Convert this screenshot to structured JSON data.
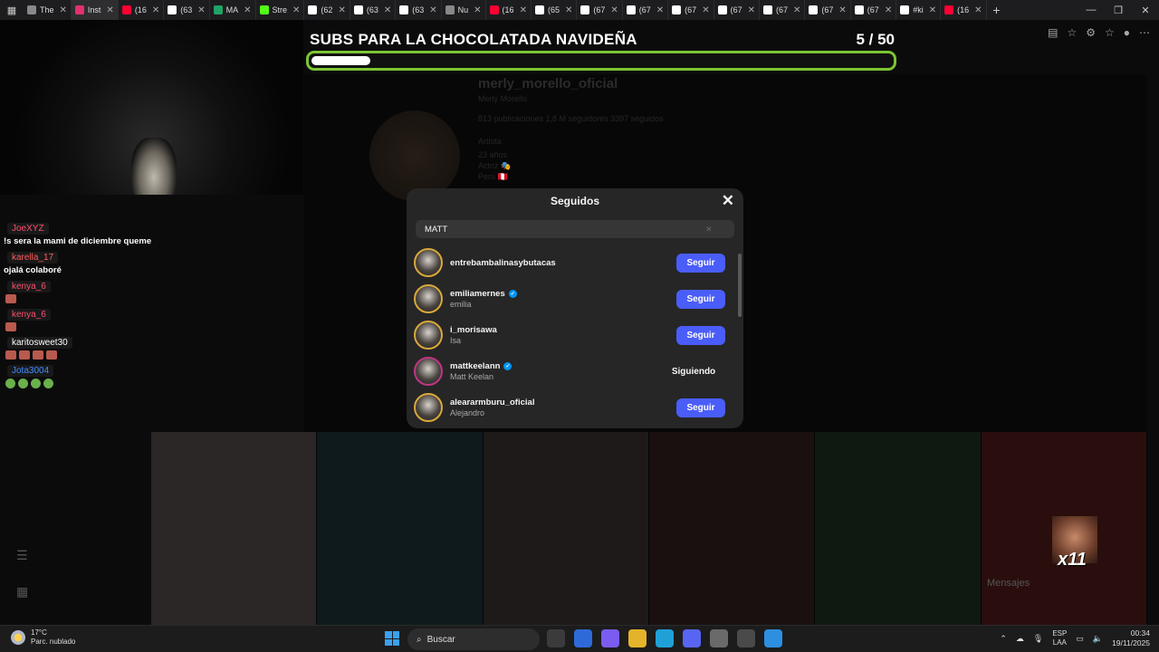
{
  "browser": {
    "tabs": [
      {
        "label": "The",
        "color": "#888888"
      },
      {
        "label": "Inst",
        "color": "#e1306c",
        "active": true
      },
      {
        "label": "(16",
        "color": "#ff0033"
      },
      {
        "label": "(63",
        "color": "#ffffff"
      },
      {
        "label": "MA",
        "color": "#21a366"
      },
      {
        "label": "Stre",
        "color": "#53fc18"
      },
      {
        "label": "(62",
        "color": "#ffffff"
      },
      {
        "label": "(63",
        "color": "#ffffff"
      },
      {
        "label": "(63",
        "color": "#ffffff"
      },
      {
        "label": "Nu",
        "color": "#888888"
      },
      {
        "label": "(16",
        "color": "#ff0033"
      },
      {
        "label": "(65",
        "color": "#ffffff"
      },
      {
        "label": "(67",
        "color": "#ffffff"
      },
      {
        "label": "(67",
        "color": "#ffffff"
      },
      {
        "label": "(67",
        "color": "#ffffff"
      },
      {
        "label": "(67",
        "color": "#ffffff"
      },
      {
        "label": "(67",
        "color": "#ffffff"
      },
      {
        "label": "(67",
        "color": "#ffffff"
      },
      {
        "label": "(67",
        "color": "#ffffff"
      },
      {
        "label": "#ki",
        "color": "#ffffff"
      },
      {
        "label": "(16",
        "color": "#ff0033"
      }
    ]
  },
  "overlay": {
    "goal_title": "SUBS PARA LA CHOCOLATADA NAVIDEÑA",
    "goal_current": 5,
    "goal_total": 50,
    "goal_count_text": "5  / 50",
    "goal_fill_fraction": 0.1,
    "accent": "#7cc533"
  },
  "profile": {
    "username": "merly_morello_oficial",
    "fullname": "Merly Morello",
    "stats": "813 publicaciones    1,8 M seguidores    3397 seguidos",
    "bio1": "Artista",
    "bio2": "23 años",
    "bio3": "Actriz 🎭",
    "bio4": "Perú 🇵🇪"
  },
  "chat": [
    {
      "user": "JoeXYZ",
      "user_color": "#ff4f6d",
      "msg": "!s sera la mami de diciembre queme"
    },
    {
      "user": "karella_17",
      "user_color": "#ff5b5b",
      "msg": "ojalá colaboré"
    },
    {
      "user": "kenya_6",
      "user_color": "#ff4f6d",
      "emotes": 1
    },
    {
      "user": "kenya_6",
      "user_color": "#ff4f6d",
      "emotes": 1
    },
    {
      "user": "karitosweet30",
      "user_color": "#ffffff",
      "emotes": 4
    },
    {
      "user": "Jota3004",
      "user_color": "#3d8eff",
      "green_emotes": 4
    }
  ],
  "modal": {
    "title": "Seguidos",
    "search_value": "MATT",
    "follow_label": "Seguir",
    "following_label": "Siguiendo",
    "rows": [
      {
        "username": "entrebambalinasybutacas",
        "fullname": "",
        "verified": false,
        "following": false
      },
      {
        "username": "emiliamernes",
        "fullname": "emilia",
        "verified": true,
        "following": false
      },
      {
        "username": "i_morisawa",
        "fullname": "Isa",
        "verified": false,
        "following": false
      },
      {
        "username": "mattkeelann",
        "fullname": "Matt Keelan",
        "verified": true,
        "following": true
      },
      {
        "username": "aleararmburu_oficial",
        "fullname": "Alejandro",
        "verified": false,
        "following": false
      }
    ]
  },
  "extras": {
    "mensajes": "Mensajes",
    "emote_multiplier": "x11"
  },
  "taskbar": {
    "temp": "17°C",
    "weather": "Parc. nublado",
    "search": "Buscar",
    "lang1": "ESP",
    "lang2": "LAA",
    "time": "00:34",
    "date": "19/11/2025"
  }
}
